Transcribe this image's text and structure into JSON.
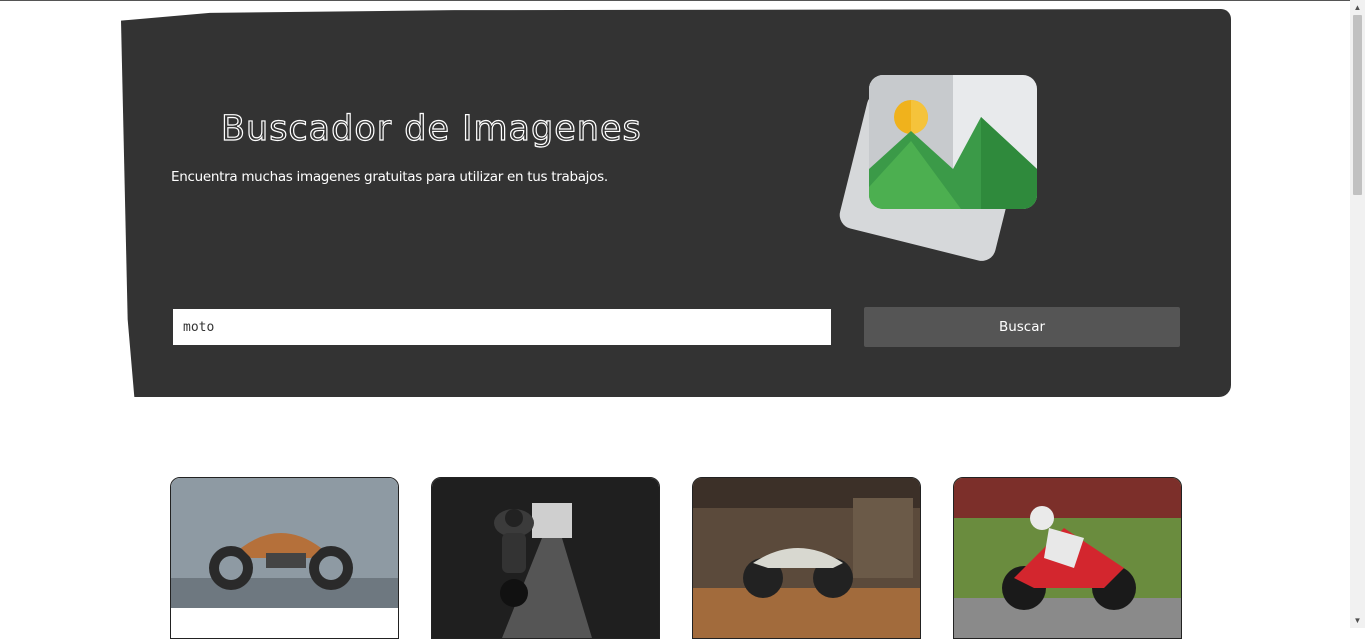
{
  "hero": {
    "title": "Buscador de Imagenes",
    "subtitle": "Encuentra muchas imagenes gratuitas para utilizar en tus trabajos."
  },
  "search": {
    "value": "moto",
    "placeholder": "",
    "button_label": "Buscar"
  },
  "results": [
    {
      "icon": "motorcycle-photo-1"
    },
    {
      "icon": "motorcycle-photo-2"
    },
    {
      "icon": "motorcycle-photo-3"
    },
    {
      "icon": "motorcycle-photo-4"
    }
  ],
  "colors": {
    "hero_bg": "#333333",
    "button_bg": "#555555",
    "icon_green": "#4caf50",
    "icon_sun": "#f0b21c"
  }
}
